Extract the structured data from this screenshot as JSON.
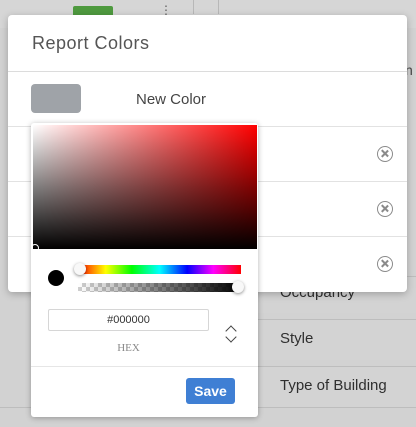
{
  "background": {
    "right_edge_letter": "n",
    "rows": [
      {
        "label": "Occupancy"
      },
      {
        "label": "Style"
      },
      {
        "label": "Type of Building"
      }
    ]
  },
  "modal": {
    "title": "Report Colors",
    "new_color_label": "New Color",
    "new_color_swatch": "#9fa3a8"
  },
  "picker": {
    "hex_value": "#000000",
    "hex_label": "HEX",
    "save_label": "Save",
    "base_hue": "#ff0000",
    "current_color": "#000000",
    "accent": "#3f7fd4"
  }
}
